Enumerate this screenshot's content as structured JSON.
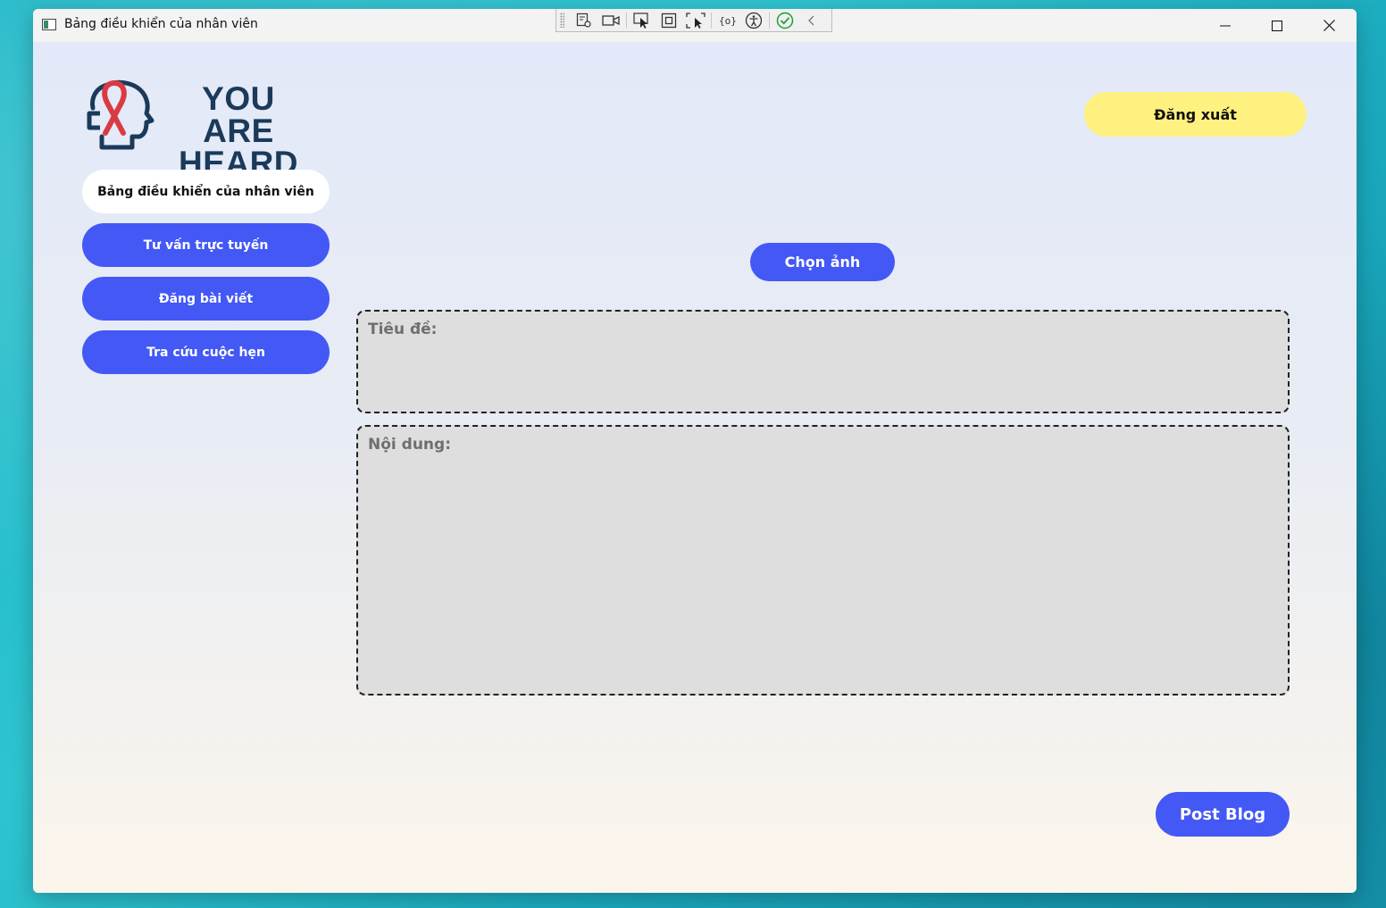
{
  "window": {
    "title": "Bảng điều khiển của nhân viên"
  },
  "devtools": {
    "icons": [
      "select-element-icon",
      "record-video-icon",
      "pointer-select-icon",
      "layout-bounds-icon",
      "track-focus-icon",
      "binding-icon",
      "accessibility-icon",
      "status-check-icon",
      "collapse-chevron-icon"
    ]
  },
  "logo": {
    "line1": "YOU ARE",
    "line2": "HEARD",
    "ribbon_color": "#d93a44",
    "outline_color": "#1b3a5a"
  },
  "sidebar": {
    "items": [
      {
        "label": "Bảng điều khiển của nhân viên",
        "active": true
      },
      {
        "label": "Tư vấn trực tuyến",
        "active": false
      },
      {
        "label": "Đăng bài viết",
        "active": false
      },
      {
        "label": "Tra cứu cuộc hẹn",
        "active": false
      }
    ]
  },
  "header": {
    "logout_label": "Đăng xuất"
  },
  "editor": {
    "choose_image_label": "Chọn ảnh",
    "title_label": "Tiêu đề:",
    "title_value": "",
    "content_label": "Nội dung:",
    "content_value": "",
    "post_label": "Post Blog"
  },
  "colors": {
    "accent": "#4358f5",
    "logout": "#fff17f",
    "field_bg": "#dedede"
  }
}
